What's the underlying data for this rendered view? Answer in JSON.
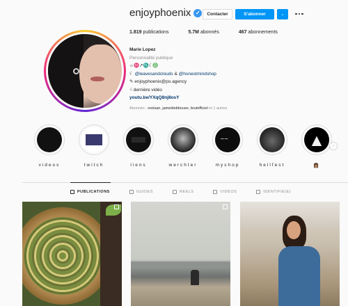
{
  "profile": {
    "username": "enjoyphoenix",
    "verified_mark": "✓",
    "contact_label": "Contacter",
    "follow_label": "S'abonner",
    "dropdown_glyph": "⌄",
    "stats": {
      "posts_value": "1.819",
      "posts_label": "publications",
      "followers_value": "5.7M",
      "followers_label": "abonnés",
      "following_value": "467",
      "following_label": "abonnements"
    },
    "bio": {
      "name": "Marie Lopez",
      "category": "Personnalité publique",
      "line_symbols": "☼♓↗♏☾♎",
      "line_mentions_prefix": "☾ ",
      "mention_1": "@leavesandclouds",
      "mention_sep": " & ",
      "mention_2": "@honestmindshop",
      "line_email": "✎ enjoyphoenix@po.agency",
      "line_video": "☟ dernière vidéo",
      "link": "youtu.be/YXqQ8nj8osY"
    },
    "followed_by": {
      "prefix": "Abonnés : ",
      "names": "orelsan, jameldebbouze, brutofficiel",
      "suffix": " et 1 autres"
    }
  },
  "highlights": [
    {
      "label": "videos",
      "style": "videos"
    },
    {
      "label": "twitch",
      "style": "twitch"
    },
    {
      "label": "liens",
      "style": "liens"
    },
    {
      "label": "werchter",
      "style": "werch"
    },
    {
      "label": "myshop",
      "style": "shop"
    },
    {
      "label": "hellfest",
      "style": "hellfest"
    },
    {
      "label": "👩🏽",
      "style": "last"
    }
  ],
  "highlights_display": [
    "videos",
    "twitch",
    "liens",
    "werchter",
    "myshop",
    "hellfest",
    "👩🏽"
  ],
  "tabs": [
    {
      "label": "PUBLICATIONS",
      "active": true
    },
    {
      "label": "GUIDES",
      "active": false
    },
    {
      "label": "REELS",
      "active": false
    },
    {
      "label": "VIDÉOS",
      "active": false
    },
    {
      "label": "IDENTIFIÉ(E)",
      "active": false
    }
  ],
  "scroll_glyph": "›"
}
